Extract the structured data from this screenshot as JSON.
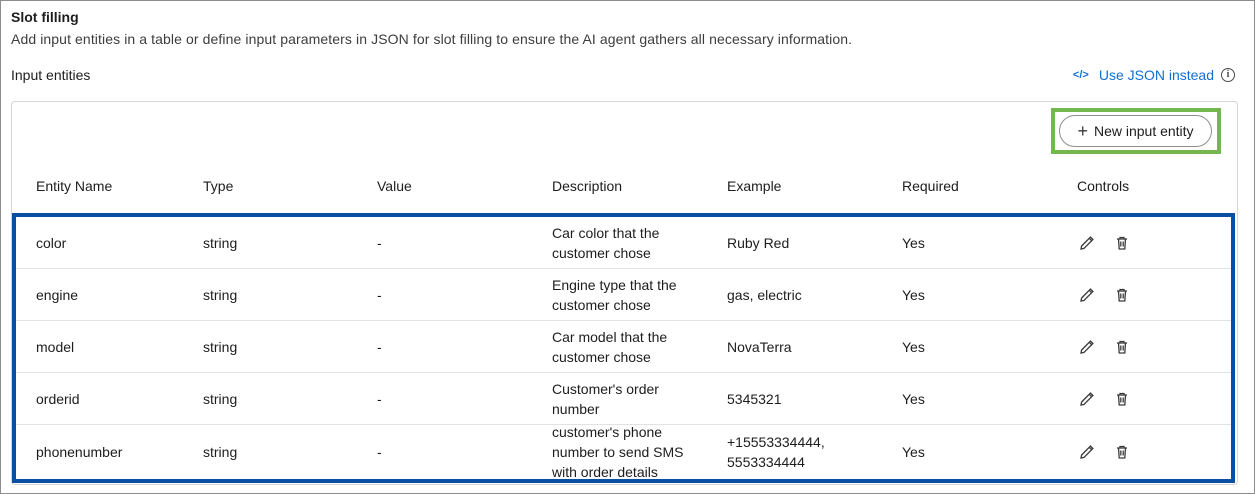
{
  "section": {
    "title": "Slot filling",
    "subtitle": "Add input entities in a table or define input parameters in JSON for slot filling to ensure the AI agent gathers all necessary information.",
    "entities_label": "Input entities",
    "json_link_icon": "</>",
    "json_link_label": "Use JSON instead",
    "info_icon": "i"
  },
  "toolbar": {
    "new_entity_label": "New input entity",
    "plus_icon": "+"
  },
  "table": {
    "headers": {
      "name": "Entity Name",
      "type": "Type",
      "value": "Value",
      "description": "Description",
      "example": "Example",
      "required": "Required",
      "controls": "Controls"
    },
    "rows": [
      {
        "name": "color",
        "type": "string",
        "value": "-",
        "description_lines": [
          "Car color that the",
          "customer chose"
        ],
        "example_lines": [
          "Ruby Red"
        ],
        "required": "Yes"
      },
      {
        "name": "engine",
        "type": "string",
        "value": "-",
        "description_lines": [
          "Engine type that the",
          "customer chose"
        ],
        "example_lines": [
          "gas, electric"
        ],
        "required": "Yes"
      },
      {
        "name": "model",
        "type": "string",
        "value": "-",
        "description_lines": [
          "Car model that the",
          "customer chose"
        ],
        "example_lines": [
          "NovaTerra"
        ],
        "required": "Yes"
      },
      {
        "name": "orderid",
        "type": "string",
        "value": "-",
        "description_lines": [
          "Customer's order",
          "number"
        ],
        "example_lines": [
          "5345321"
        ],
        "required": "Yes"
      },
      {
        "name": "phonenumber",
        "type": "string",
        "value": "-",
        "description_lines": [
          "customer's phone",
          "number to send SMS",
          "with order details"
        ],
        "example_lines": [
          "+15553334444,",
          "5553334444"
        ],
        "required": "Yes"
      }
    ]
  },
  "colors": {
    "highlight_green": "#72b84e",
    "highlight_blue": "#0a4fa3",
    "link_blue": "#1170cf"
  },
  "icons": {
    "edit": "pencil-icon",
    "delete": "trash-icon"
  }
}
